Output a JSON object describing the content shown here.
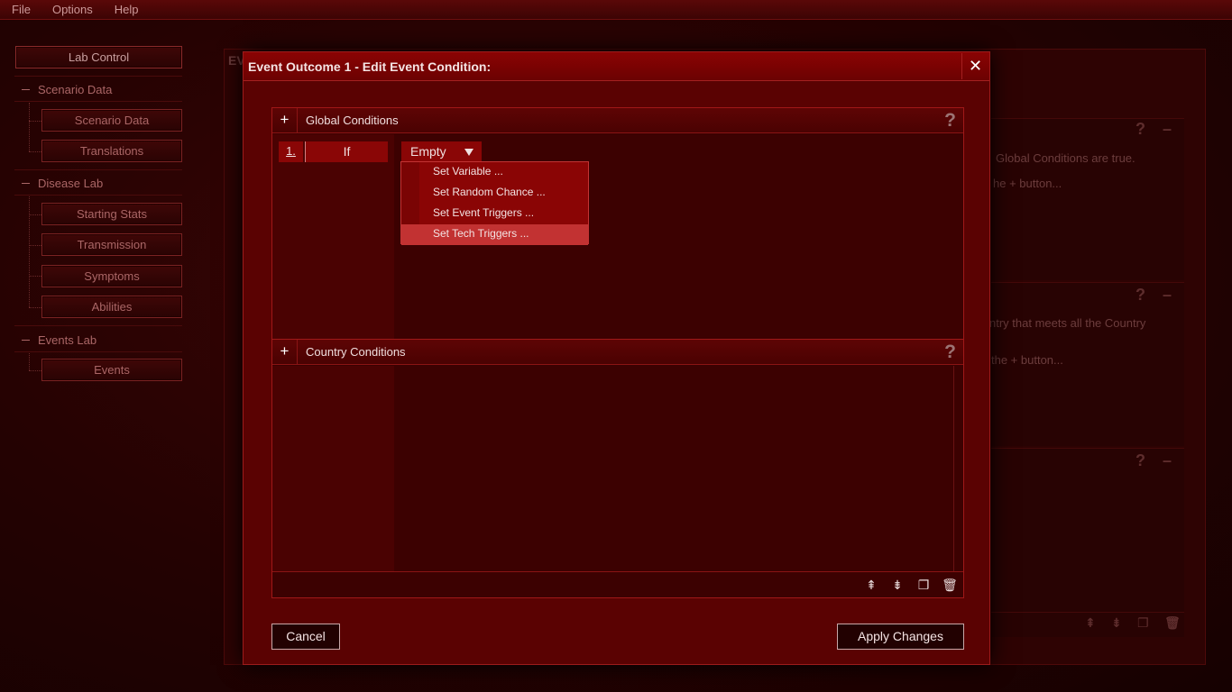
{
  "menubar": {
    "items": [
      "File",
      "Options",
      "Help"
    ]
  },
  "nav": {
    "lab_control": "Lab Control",
    "groups": [
      {
        "label": "Scenario Data",
        "items": [
          "Scenario Data",
          "Translations"
        ]
      },
      {
        "label": "Disease Lab",
        "items": [
          "Starting Stats",
          "Transmission",
          "Symptoms",
          "Abilities"
        ]
      },
      {
        "label": "Events Lab",
        "items": [
          "Events"
        ]
      }
    ]
  },
  "background": {
    "panel_label": "EV",
    "texts": [
      "Global Conditions are true.",
      "he + button...",
      "ntry that meets all the Country",
      "the + button..."
    ]
  },
  "dialog": {
    "title": "Event Outcome 1 - Edit Event Condition:",
    "close_glyph": "✕",
    "global": {
      "title": "Global Conditions",
      "help": "?",
      "row": {
        "number": "1.",
        "keyword": "If",
        "dropdown_value": "Empty"
      },
      "dropdown_options": [
        "Set Variable ...",
        "Set Random Chance ...",
        "Set Event Triggers ...",
        "Set Tech Triggers ..."
      ],
      "highlighted_option": "Set Tech Triggers ..."
    },
    "country": {
      "title": "Country Conditions",
      "help": "?"
    },
    "cancel_label": "Cancel",
    "apply_label": "Apply Changes"
  }
}
